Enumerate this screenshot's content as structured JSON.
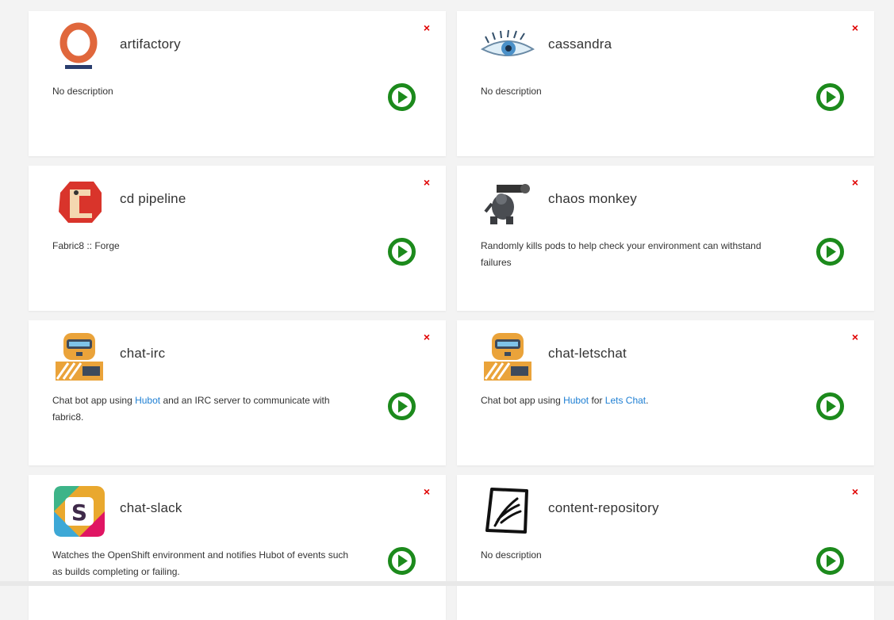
{
  "apps": [
    {
      "key": "artifactory",
      "name": "artifactory",
      "icon": "artifactory-logo-icon",
      "description": [
        "No description"
      ]
    },
    {
      "key": "cassandra",
      "name": "cassandra",
      "icon": "cassandra-eye-logo-icon",
      "description": [
        "No description"
      ]
    },
    {
      "key": "cd-pipeline",
      "name": "cd pipeline",
      "icon": "cd-pipeline-logo-icon",
      "description": [
        "Fabric8 :: Forge"
      ]
    },
    {
      "key": "chaos-monkey",
      "name": "chaos monkey",
      "icon": "chaos-monkey-logo-icon",
      "description": [
        "Randomly kills pods to help check your environment can withstand failures"
      ]
    },
    {
      "key": "chat-irc",
      "name": "chat-irc",
      "icon": "hubot-robot-logo-icon",
      "description": [
        "Chat bot app using ",
        {
          "link": "Hubot"
        },
        " and an IRC server to communicate with fabric8."
      ]
    },
    {
      "key": "chat-letschat",
      "name": "chat-letschat",
      "icon": "hubot-robot-logo-icon",
      "description": [
        "Chat bot app using ",
        {
          "link": "Hubot"
        },
        " for ",
        {
          "link": "Lets Chat"
        },
        "."
      ]
    },
    {
      "key": "chat-slack",
      "name": "chat-slack",
      "icon": "slack-logo-icon",
      "description": [
        "Watches the OpenShift environment and notifies Hubot of events such as builds completing or failing."
      ]
    },
    {
      "key": "content-repository",
      "name": "content-repository",
      "icon": "content-repository-logo-icon",
      "description": [
        "No description"
      ]
    }
  ],
  "colors": {
    "run_green": "#1c8a1c",
    "close_red": "#e00000",
    "link_blue": "#1e7fd3"
  },
  "icons": {
    "close": "×",
    "run": "play-circle-icon"
  }
}
